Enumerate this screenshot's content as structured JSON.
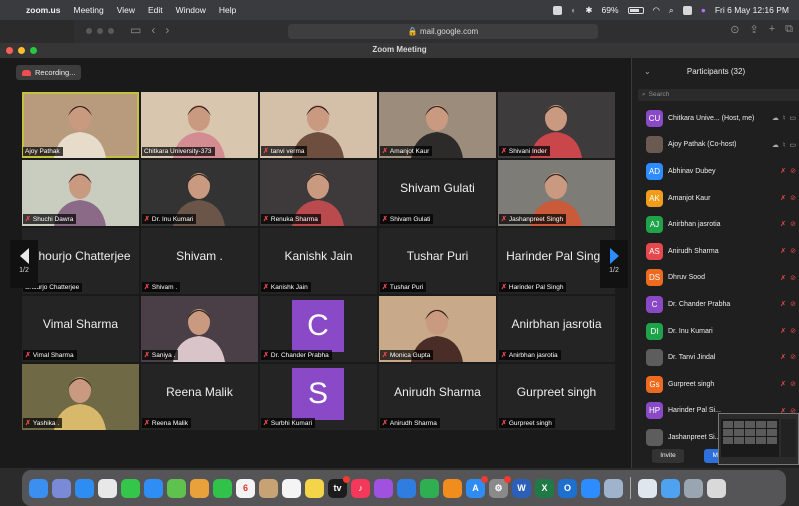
{
  "menubar": {
    "app": "zoom.us",
    "items": [
      "Meeting",
      "View",
      "Edit",
      "Window",
      "Help"
    ],
    "battery": "69%",
    "datetime": "Fri 6 May  12:16 PM"
  },
  "browser": {
    "url": "mail.google.com"
  },
  "window": {
    "title": "Zoom Meeting"
  },
  "recording": {
    "label": "Recording..."
  },
  "pagination": {
    "left_page": "1/2",
    "right_page": "1/2"
  },
  "tiles": [
    {
      "name": "Ajoy Pathak",
      "muted": false,
      "kind": "video",
      "active": true,
      "bg": "#b79b7c",
      "fg": "#e6dcc9"
    },
    {
      "name": "Chitkara University-373",
      "muted": false,
      "kind": "video",
      "bg": "#d9c6ae",
      "fg": "#d38d92"
    },
    {
      "name": "tanvi verma",
      "muted": true,
      "kind": "video",
      "bg": "#d4bfa8",
      "fg": "#6e4e3e"
    },
    {
      "name": "Amanjot Kaur",
      "muted": true,
      "kind": "video",
      "bg": "#9b8c7c",
      "fg": "#2d2a2a"
    },
    {
      "name": "Shivani Inder",
      "muted": true,
      "kind": "video",
      "bg": "#3e3b3d",
      "fg": "#c9464b"
    },
    {
      "name": "Shuchi Dawra",
      "muted": true,
      "kind": "video",
      "bg": "#c9cdbf",
      "fg": "#8a6a86"
    },
    {
      "name": "Dr. Inu Kumari",
      "muted": true,
      "kind": "video",
      "bg": "#333333",
      "fg": "#6a5548"
    },
    {
      "name": "Renuka Sharma",
      "muted": true,
      "kind": "video",
      "bg": "#3e3a3c",
      "fg": "#b94a4e"
    },
    {
      "name": "Shivam Gulati",
      "muted": true,
      "kind": "name",
      "display": "Shivam Gulati"
    },
    {
      "name": "Jashanpreet Singh",
      "muted": true,
      "kind": "video",
      "bg": "#7e7c76",
      "fg": "#c95a3a"
    },
    {
      "name": "Shourjo Chatterjee",
      "muted": false,
      "kind": "name",
      "display": "Shourjo Chatterjee"
    },
    {
      "name": "Shivam .",
      "muted": true,
      "kind": "name",
      "display": "Shivam ."
    },
    {
      "name": "Kanishk Jain",
      "muted": true,
      "kind": "name",
      "display": "Kanishk Jain"
    },
    {
      "name": "Tushar Puri",
      "muted": true,
      "kind": "name",
      "display": "Tushar Puri"
    },
    {
      "name": "Harinder Pal Singh",
      "muted": true,
      "kind": "name",
      "display": "Harinder Pal Singh"
    },
    {
      "name": "Vimal Sharma",
      "muted": true,
      "kind": "name",
      "display": "Vimal Sharma"
    },
    {
      "name": "Saniya .",
      "muted": true,
      "kind": "video",
      "bg": "#4a3f46",
      "fg": "#d8c4c9"
    },
    {
      "name": "Dr. Chander Prabha",
      "muted": true,
      "kind": "letter",
      "letter": "C",
      "color": "#8a49c7"
    },
    {
      "name": "Monica Gupta",
      "muted": true,
      "kind": "video",
      "bg": "#c8a98a",
      "fg": "#4b2d27"
    },
    {
      "name": "Anirbhan jasrotia",
      "muted": true,
      "kind": "name",
      "display": "Anirbhan jasrotia"
    },
    {
      "name": "Yashika .",
      "muted": true,
      "kind": "video",
      "bg": "#6f6a45",
      "fg": "#d8b86b"
    },
    {
      "name": "Reena Malik",
      "muted": true,
      "kind": "name",
      "display": "Reena Malik"
    },
    {
      "name": "Surbhi Kumari",
      "muted": true,
      "kind": "letter",
      "letter": "S",
      "color": "#8a49c7"
    },
    {
      "name": "Anirudh Sharma",
      "muted": true,
      "kind": "name",
      "display": "Anirudh Sharma"
    },
    {
      "name": "Gurpreet singh",
      "muted": true,
      "kind": "name",
      "display": "Gurpreet singh"
    }
  ],
  "participants": {
    "title": "Participants (32)",
    "search_placeholder": "Search",
    "list": [
      {
        "initials": "CU",
        "name": "Chitkara Unive... (Host, me)",
        "color": "#8a49c7",
        "mic_on": true
      },
      {
        "initials": "",
        "name": "Ajoy Pathak (Co-host)",
        "color": "#6b5a52",
        "mic_on": true
      },
      {
        "initials": "AD",
        "name": "Abhinav Dubey",
        "color": "#2d8cff"
      },
      {
        "initials": "AK",
        "name": "Amanjot Kaur",
        "color": "#f29d1a"
      },
      {
        "initials": "AJ",
        "name": "Anirbhan jasrotia",
        "color": "#1fa34a"
      },
      {
        "initials": "AS",
        "name": "Anirudh Sharma",
        "color": "#e5484d"
      },
      {
        "initials": "DS",
        "name": "Dhruv Sood",
        "color": "#ee6a1f"
      },
      {
        "initials": "C",
        "name": "Dr. Chander Prabha",
        "color": "#8a49c7"
      },
      {
        "initials": "DI",
        "name": "Dr. Inu Kumari",
        "color": "#1fa34a"
      },
      {
        "initials": "",
        "name": "Dr. Tanvi Jindal",
        "color": "#5d5d5d"
      },
      {
        "initials": "Gs",
        "name": "Gurpreet singh",
        "color": "#ee6a1f"
      },
      {
        "initials": "HP",
        "name": "Harinder Pal Si...",
        "color": "#8a49c7"
      },
      {
        "initials": "",
        "name": "Jashanpreet Si...",
        "color": "#5d5d5d"
      }
    ],
    "invite_label": "Invite",
    "mute_all_label": "Mu"
  },
  "dock": {
    "apps": [
      {
        "name": "finder-icon",
        "color": "#3b8ff0",
        "glyph": ""
      },
      {
        "name": "launchpad-icon",
        "color": "#7b8ad6",
        "glyph": ""
      },
      {
        "name": "safari-icon",
        "color": "#2e8df2",
        "glyph": ""
      },
      {
        "name": "chrome-icon",
        "color": "#e8e8e8",
        "glyph": ""
      },
      {
        "name": "messages-icon",
        "color": "#33c64a",
        "glyph": ""
      },
      {
        "name": "mail-icon",
        "color": "#2f8ef6",
        "glyph": ""
      },
      {
        "name": "maps-icon",
        "color": "#5fc14e",
        "glyph": ""
      },
      {
        "name": "photos-icon",
        "color": "#e9a23b",
        "glyph": ""
      },
      {
        "name": "facetime-icon",
        "color": "#31c24a",
        "glyph": ""
      },
      {
        "name": "calendar-icon",
        "color": "#f3f3f3",
        "glyph": "6",
        "dark": true
      },
      {
        "name": "contacts-icon",
        "color": "#c7a274",
        "glyph": ""
      },
      {
        "name": "reminders-icon",
        "color": "#f4f4f4",
        "glyph": ""
      },
      {
        "name": "notes-icon",
        "color": "#f4d54a",
        "glyph": ""
      },
      {
        "name": "tv-icon",
        "color": "#1c1c1c",
        "glyph": "tv",
        "badge": true
      },
      {
        "name": "music-icon",
        "color": "#f4385b",
        "glyph": "♪"
      },
      {
        "name": "podcasts-icon",
        "color": "#a051e0",
        "glyph": ""
      },
      {
        "name": "keynote-icon",
        "color": "#2f7de0",
        "glyph": ""
      },
      {
        "name": "numbers-icon",
        "color": "#2fae52",
        "glyph": ""
      },
      {
        "name": "pages-icon",
        "color": "#f08d1c",
        "glyph": ""
      },
      {
        "name": "app-store-icon",
        "color": "#2f8cf3",
        "glyph": "A",
        "badge": true
      },
      {
        "name": "system-preferences-icon",
        "color": "#8a8a8a",
        "glyph": "⚙",
        "badge": true
      },
      {
        "name": "word-icon",
        "color": "#2b5fb8",
        "glyph": "W"
      },
      {
        "name": "excel-icon",
        "color": "#1f7a45",
        "glyph": "X"
      },
      {
        "name": "outlook-icon",
        "color": "#1d6fd0",
        "glyph": "O"
      },
      {
        "name": "zoom-icon",
        "color": "#2d8cff",
        "glyph": ""
      },
      {
        "name": "preview-icon",
        "color": "#9fb4cc",
        "glyph": ""
      }
    ],
    "tail": [
      {
        "name": "documents-folder-icon",
        "color": "#dfe6ee"
      },
      {
        "name": "downloads-folder-icon",
        "color": "#4fa2f0"
      },
      {
        "name": "screenshot-stack-icon",
        "color": "#9aa5b2"
      },
      {
        "name": "trash-icon",
        "color": "#d9d9d9"
      }
    ]
  }
}
